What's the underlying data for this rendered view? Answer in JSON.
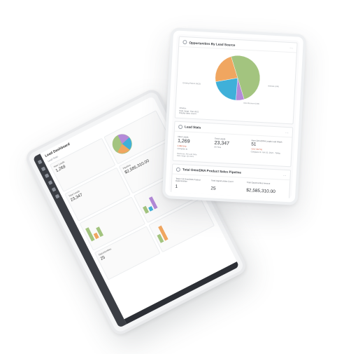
{
  "colors": {
    "green": "#a3c47f",
    "orange": "#f0a660",
    "blue": "#3fb0d9",
    "purple": "#b48ad9",
    "dark_rail": "#3b3e44"
  },
  "back_tablet": {
    "title": "Lead Dashboard",
    "subtitle": "Lead Stats",
    "stats": [
      {
        "caption": "New Leads",
        "value": "1,269"
      },
      {
        "caption": "Total Leads",
        "value": "23,347"
      },
      {
        "caption": "Pipeline",
        "value": "$2,585,310.00"
      },
      {
        "caption": "Opportunities",
        "value": "25"
      }
    ]
  },
  "opportunities_panel": {
    "title": "Opportunities By Lead Source",
    "more_icon": "ellipsis-icon",
    "pie_labels": {
      "left": "Existing Patient (NCS)",
      "right": "Website (AM)",
      "bottom": "Advertisement (AM)"
    },
    "meta": [
      "Chartex",
      "Date range: Year 2021",
      "Display data: Count"
    ],
    "chart_data": {
      "type": "pie",
      "title": "Opportunities By Lead Source",
      "slices": [
        {
          "value": 50,
          "color": "#a3c47f"
        },
        {
          "value": 6,
          "color": "#b48ad9"
        },
        {
          "value": 21,
          "color": "#3fb0d9"
        },
        {
          "value": 23,
          "color": "#f0a660"
        }
      ]
    }
  },
  "lead_stats_panel": {
    "title": "Lead Stats",
    "new_leads_label": "New Leads",
    "new_leads_value": "1,269",
    "new_leads_note": "2,488 Sep",
    "new_leads_note2": "Compare to",
    "total_leads_label": "Total Leads",
    "total_leads_value": "23,347",
    "total_leads_note2": "All Time",
    "omni_label": "New OmniDNA Leads Last Week",
    "omni_value": "51",
    "omni_note": "+34 (+207%)",
    "omni_note2": "Compare to: Jan 10, 2021 - Today",
    "meta_left": [
      "Measures: All Lead Data",
      "Date range: Q4 2021"
    ]
  },
  "pipeline_panel": {
    "title": "Total OmniDNA Product Sales Pipeline",
    "col1_label": "Total # Of OmniDNA Product Opportunities",
    "col1_value": "1",
    "col2_label": "Total Opportunities Count",
    "col2_value": "25",
    "col3_label": "Total Opportunities Amount",
    "col3_value": "$2,585,310.00"
  }
}
